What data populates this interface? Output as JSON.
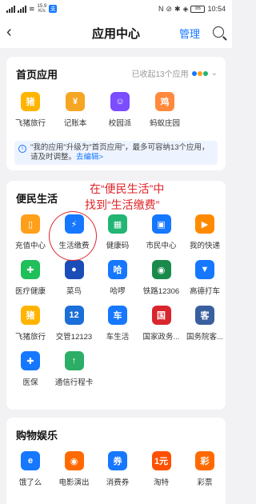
{
  "status": {
    "left_speed": "15.9",
    "left_unit": "K/s",
    "battery": "86",
    "time": "10:54"
  },
  "header": {
    "title": "应用中心",
    "manage": "管理"
  },
  "home": {
    "title": "首页应用",
    "collected": "已收起13个应用",
    "apps": [
      {
        "label": "飞猪旅行",
        "icon": "pig-icon",
        "color": "#ffb400",
        "glyph": "猪"
      },
      {
        "label": "记账本",
        "icon": "ledger-icon",
        "color": "#f5a623",
        "glyph": "¥"
      },
      {
        "label": "校园派",
        "icon": "smile-icon",
        "color": "#7b4dff",
        "glyph": "☺"
      },
      {
        "label": "蚂蚁庄园",
        "icon": "chick-icon",
        "color": "#ff8a3d",
        "glyph": "鸡"
      }
    ],
    "notice_text": "\"我的应用\"升级为\"首页应用\"，最多可容纳13个应用，请及时调整。",
    "notice_link": "去编辑>"
  },
  "convenience": {
    "title": "便民生活",
    "apps": [
      {
        "label": "充值中心",
        "icon": "phone-icon",
        "color": "#ff9f1a",
        "glyph": "▯"
      },
      {
        "label": "生活缴费",
        "icon": "bolt-icon",
        "color": "#1677ff",
        "glyph": "⚡"
      },
      {
        "label": "健康码",
        "icon": "health-code-icon",
        "color": "#22b573",
        "glyph": "▦"
      },
      {
        "label": "市民中心",
        "icon": "citizen-icon",
        "color": "#1677ff",
        "glyph": "▣"
      },
      {
        "label": "我的快递",
        "icon": "truck-icon",
        "color": "#ff8a00",
        "glyph": "▶"
      },
      {
        "label": "医疗健康",
        "icon": "medical-icon",
        "color": "#1fbf5a",
        "glyph": "✚"
      },
      {
        "label": "菜鸟",
        "icon": "cainiao-icon",
        "color": "#1a4db8",
        "glyph": "●"
      },
      {
        "label": "哈啰",
        "icon": "hello-icon",
        "color": "#1677ff",
        "glyph": "哈"
      },
      {
        "label": "铁路12306",
        "icon": "railway-icon",
        "color": "#1a8a4a",
        "glyph": "◉"
      },
      {
        "label": "高德打车",
        "icon": "amap-icon",
        "color": "#1677ff",
        "glyph": "▼"
      },
      {
        "label": "飞猪旅行",
        "icon": "pig-icon",
        "color": "#ffb400",
        "glyph": "猪"
      },
      {
        "label": "交管12123",
        "icon": "traffic-icon",
        "color": "#1a6fd8",
        "glyph": "12"
      },
      {
        "label": "车生活",
        "icon": "car-icon",
        "color": "#1677ff",
        "glyph": "车"
      },
      {
        "label": "国家政务...",
        "icon": "gov-icon",
        "color": "#d9262c",
        "glyph": "国"
      },
      {
        "label": "国务院客...",
        "icon": "state-council-icon",
        "color": "#3a5f9e",
        "glyph": "客"
      },
      {
        "label": "医保",
        "icon": "insurance-icon",
        "color": "#1677ff",
        "glyph": "✚"
      },
      {
        "label": "通信行程卡",
        "icon": "trip-card-icon",
        "color": "#2cae66",
        "glyph": "↑"
      }
    ]
  },
  "annotation": {
    "line1": "在“便民生活”中",
    "line2": "找到“生活缴费”"
  },
  "shopping": {
    "title": "购物娱乐",
    "apps": [
      {
        "label": "饿了么",
        "icon": "eleme-icon",
        "color": "#1677ff",
        "glyph": "e"
      },
      {
        "label": "电影演出",
        "icon": "movie-icon",
        "color": "#ff6a00",
        "glyph": "◉"
      },
      {
        "label": "消费券",
        "icon": "coupon-icon",
        "color": "#1677ff",
        "glyph": "券"
      },
      {
        "label": "淘特",
        "icon": "taote-icon",
        "color": "#ff5000",
        "glyph": "1元"
      },
      {
        "label": "彩票",
        "icon": "lottery-icon",
        "color": "#ff6a00",
        "glyph": "彩"
      }
    ]
  }
}
